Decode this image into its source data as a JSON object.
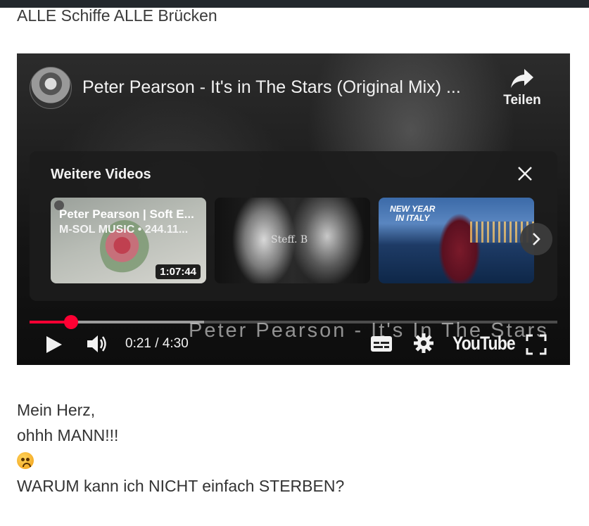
{
  "page": {
    "heading": "ALLE Schiffe ALLE Brücken",
    "paragraph_lines": [
      "Mein Herz,",
      "ohhh MANN!!!",
      "WARUM kann ich NICHT einfach STERBEN?"
    ],
    "emoji": "flushed-face"
  },
  "player": {
    "video_title": "Peter Pearson - It's in The Stars (Original Mix) ...",
    "share_label": "Teilen",
    "more_videos_title": "Weitere Videos",
    "thumbnails": [
      {
        "title": "Peter Pearson | Soft E...",
        "subtitle": "M-SOL MUSIC • 244.11...",
        "duration": "1:07:44"
      },
      {
        "signature": "Steff. B"
      },
      {
        "caption_line1": "NEW YEAR",
        "caption_line2": "IN ITALY"
      }
    ],
    "overlay_text": "Peter Pearson - It's In The Stars",
    "time_display": "0:21 / 4:30",
    "progress_fraction": 0.078,
    "buffer_fraction": 0.33,
    "logo_text": "YouTube",
    "accent_color": "#ff0033"
  }
}
